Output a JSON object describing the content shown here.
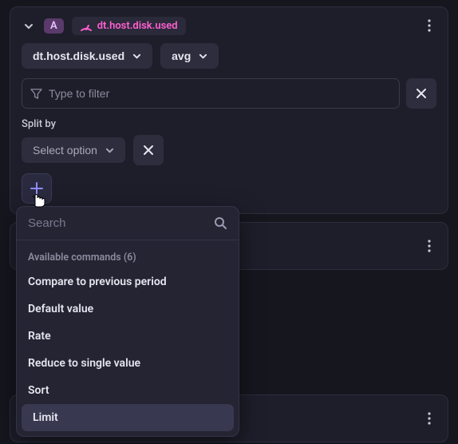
{
  "header": {
    "badge": "A",
    "metric": "dt.host.disk.used"
  },
  "controls": {
    "metric_selector": "dt.host.disk.used",
    "aggregation": "avg"
  },
  "filter": {
    "placeholder": "Type to filter"
  },
  "splitby": {
    "label": "Split by",
    "select_placeholder": "Select option"
  },
  "popover": {
    "search_placeholder": "Search",
    "heading": "Available commands (6)",
    "items": [
      "Compare to previous period",
      "Default value",
      "Rate",
      "Reduce to single value",
      "Sort",
      "Limit"
    ],
    "highlighted_index": 5
  }
}
